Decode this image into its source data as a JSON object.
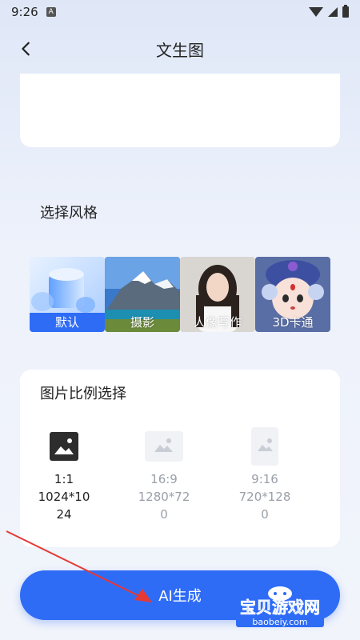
{
  "status_bar": {
    "time": "9:26",
    "icons": [
      "a-icon",
      "wifi-icon",
      "signal-icon",
      "battery-icon"
    ]
  },
  "header": {
    "title": "文生图",
    "back_icon": "chevron-left-icon"
  },
  "style_section": {
    "title": "选择风格",
    "items": [
      {
        "label": "默认",
        "selected": true
      },
      {
        "label": "摄影",
        "selected": false
      },
      {
        "label": "人像写作",
        "selected": false
      },
      {
        "label": "3D卡通",
        "selected": false
      }
    ]
  },
  "ratio_section": {
    "title": "图片比例选择",
    "options": [
      {
        "ratio": "1:1",
        "size_line1": "1024*10",
        "size_line2": "24",
        "selected": true
      },
      {
        "ratio": "16:9",
        "size_line1": "1280*72",
        "size_line2": "0",
        "selected": false
      },
      {
        "ratio": "9:16",
        "size_line1": "720*128",
        "size_line2": "0",
        "selected": false
      }
    ]
  },
  "action": {
    "label": "AI生成"
  },
  "watermark": {
    "title": "宝贝游戏网",
    "url": "baobeiy.com"
  },
  "colors": {
    "accent": "#2f6cf6",
    "inactive_text": "#9aa0a8",
    "watermark": "#2f6cf6",
    "arrow": "#e53935"
  }
}
